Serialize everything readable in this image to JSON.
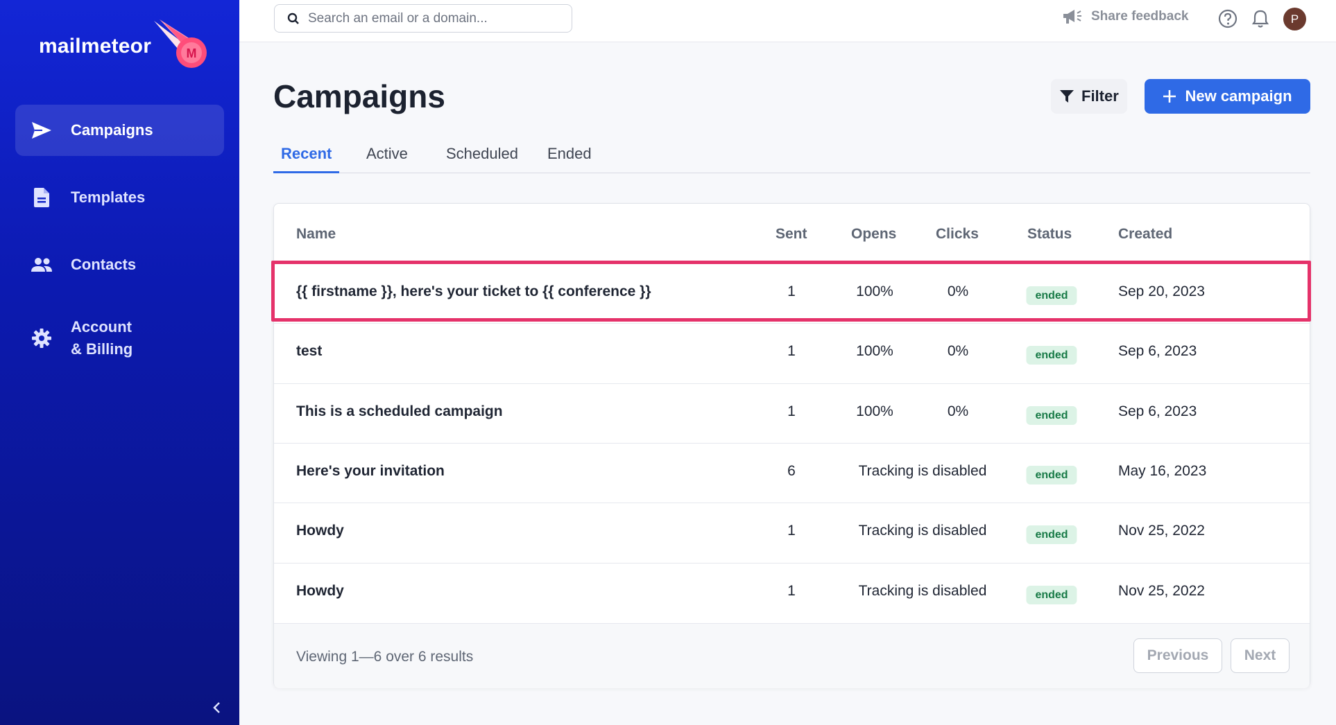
{
  "brand": {
    "name": "mailmeteor"
  },
  "sidebar": {
    "items": [
      {
        "label": "Campaigns",
        "icon": "send-icon",
        "active": true
      },
      {
        "label": "Templates",
        "icon": "document-icon",
        "active": false
      },
      {
        "label": "Contacts",
        "icon": "users-icon",
        "active": false
      },
      {
        "label": "Account\n& Billing",
        "label_line1": "Account",
        "label_line2": "& Billing",
        "icon": "gear-icon",
        "active": false
      }
    ],
    "collapse_icon": "chevron-left-icon"
  },
  "topbar": {
    "search_placeholder": "Search an email or a domain...",
    "feedback_label": "Share feedback",
    "avatar_initial": "P"
  },
  "page": {
    "title": "Campaigns",
    "filter_label": "Filter",
    "new_campaign_label": "New campaign"
  },
  "tabs": [
    {
      "label": "Recent",
      "active": true
    },
    {
      "label": "Active",
      "active": false
    },
    {
      "label": "Scheduled",
      "active": false
    },
    {
      "label": "Ended",
      "active": false
    }
  ],
  "table": {
    "columns": [
      "Name",
      "Sent",
      "Opens",
      "Clicks",
      "Status",
      "Created"
    ],
    "rows": [
      {
        "name": "{{ firstname }}, here's your ticket to {{ conference }}",
        "sent": "1",
        "opens": "100%",
        "clicks": "0%",
        "tracking": "",
        "status": "ended",
        "created": "Sep 20, 2023",
        "highlighted": true
      },
      {
        "name": "test",
        "sent": "1",
        "opens": "100%",
        "clicks": "0%",
        "tracking": "",
        "status": "ended",
        "created": "Sep 6, 2023",
        "highlighted": false
      },
      {
        "name": "This is a scheduled campaign",
        "sent": "1",
        "opens": "100%",
        "clicks": "0%",
        "tracking": "",
        "status": "ended",
        "created": "Sep 6, 2023",
        "highlighted": false
      },
      {
        "name": "Here's your invitation",
        "sent": "6",
        "opens": "",
        "clicks": "",
        "tracking": "Tracking is disabled",
        "status": "ended",
        "created": "May 16, 2023",
        "highlighted": false
      },
      {
        "name": "Howdy",
        "sent": "1",
        "opens": "",
        "clicks": "",
        "tracking": "Tracking is disabled",
        "status": "ended",
        "created": "Nov 25, 2022",
        "highlighted": false
      },
      {
        "name": "Howdy",
        "sent": "1",
        "opens": "",
        "clicks": "",
        "tracking": "Tracking is disabled",
        "status": "ended",
        "created": "Nov 25, 2022",
        "highlighted": false
      }
    ],
    "footer_text": "Viewing 1—6 over 6 results",
    "previous_label": "Previous",
    "next_label": "Next"
  },
  "colors": {
    "accent": "#2f6ae6",
    "sidebar_top": "#1326d6",
    "sidebar_bottom": "#0a1380",
    "status_bg": "#dcf3e6",
    "status_text": "#177a46",
    "highlight_border": "#e5326a"
  }
}
